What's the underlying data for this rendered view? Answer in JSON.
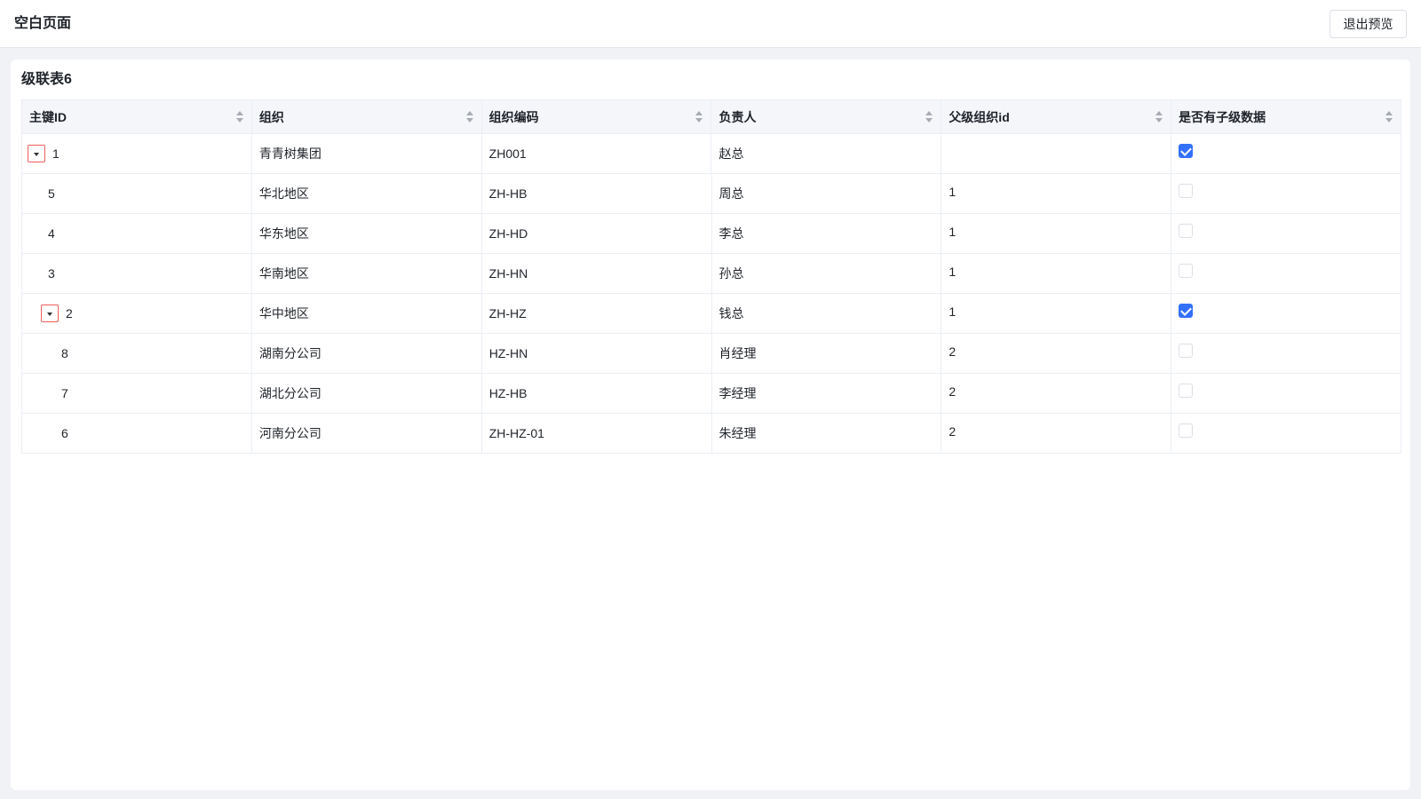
{
  "header": {
    "title": "空白页面",
    "exit_label": "退出预览"
  },
  "card": {
    "title": "级联表6"
  },
  "table": {
    "columns": [
      "主键ID",
      "组织",
      "组织编码",
      "负责人",
      "父级组织id",
      "是否有子级数据"
    ],
    "rows": [
      {
        "id": "1",
        "org": "青青树集团",
        "code": "ZH001",
        "owner": "赵总",
        "parent": "",
        "has_children": true,
        "level": 0,
        "expandable": true
      },
      {
        "id": "5",
        "org": "华北地区",
        "code": "ZH-HB",
        "owner": "周总",
        "parent": "1",
        "has_children": false,
        "level": 1,
        "expandable": false
      },
      {
        "id": "4",
        "org": "华东地区",
        "code": "ZH-HD",
        "owner": "李总",
        "parent": "1",
        "has_children": false,
        "level": 1,
        "expandable": false
      },
      {
        "id": "3",
        "org": "华南地区",
        "code": "ZH-HN",
        "owner": "孙总",
        "parent": "1",
        "has_children": false,
        "level": 1,
        "expandable": false
      },
      {
        "id": "2",
        "org": "华中地区",
        "code": "ZH-HZ",
        "owner": "钱总",
        "parent": "1",
        "has_children": true,
        "level": 1,
        "expandable": true
      },
      {
        "id": "8",
        "org": "湖南分公司",
        "code": "HZ-HN",
        "owner": "肖经理",
        "parent": "2",
        "has_children": false,
        "level": 2,
        "expandable": false
      },
      {
        "id": "7",
        "org": "湖北分公司",
        "code": "HZ-HB",
        "owner": "李经理",
        "parent": "2",
        "has_children": false,
        "level": 2,
        "expandable": false
      },
      {
        "id": "6",
        "org": "河南分公司",
        "code": "ZH-HZ-01",
        "owner": "朱经理",
        "parent": "2",
        "has_children": false,
        "level": 2,
        "expandable": false
      }
    ]
  },
  "colors": {
    "accent": "#3370ff",
    "expand_border": "#f25c5c"
  }
}
